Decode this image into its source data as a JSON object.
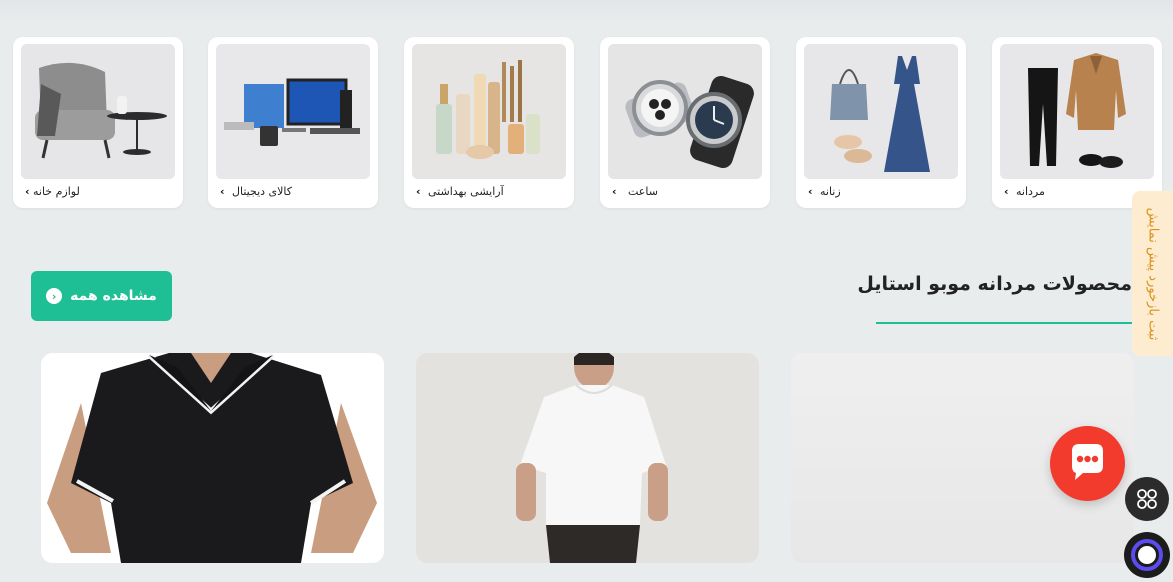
{
  "categories": [
    {
      "label": "مردانه",
      "chevron": "‹",
      "icon": "menswear-image"
    },
    {
      "label": "زنانه",
      "chevron": "‹",
      "icon": "womenswear-image"
    },
    {
      "label": "ساعت",
      "chevron": "‹",
      "icon": "watches-image"
    },
    {
      "label": "آرایشی بهداشتی",
      "chevron": "‹",
      "icon": "cosmetics-image"
    },
    {
      "label": "کالای دیجیتال",
      "chevron": "‹",
      "icon": "digital-goods-image"
    },
    {
      "label": "لوازم خانه",
      "chevron": "‹",
      "icon": "home-goods-image"
    }
  ],
  "section": {
    "title": "محصولات مردانه موبو استایل",
    "view_all_label": "مشاهده همه",
    "view_all_chevron": "‹"
  },
  "preregister_tab": {
    "label": "ثبت بازخورد پیش نمایش"
  },
  "floating": {
    "chat_icon": "chat-bubble-icon",
    "grid_icon": "grid-menu-icon"
  },
  "colors": {
    "accent": "#1fbf95",
    "chat": "#f23a2d",
    "tab_bg": "#fdecd0",
    "tab_text": "#d8921a",
    "page_bg": "#e9eced"
  }
}
